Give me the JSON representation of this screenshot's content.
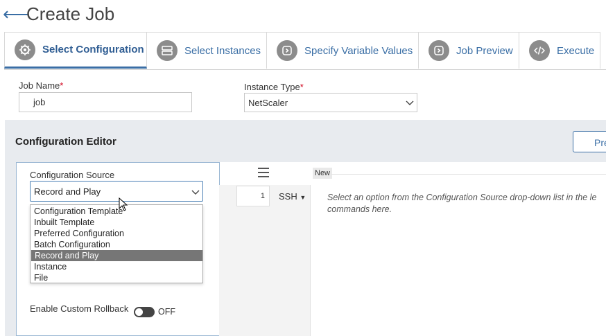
{
  "header": {
    "back_icon": "back-arrow-icon",
    "title": "Create Job"
  },
  "tabs": [
    {
      "label": "Select Configuration",
      "icon": "gear-icon",
      "active": true
    },
    {
      "label": "Select Instances",
      "icon": "server-icon",
      "active": false
    },
    {
      "label": "Specify Variable Values",
      "icon": "play-icon",
      "active": false
    },
    {
      "label": "Job Preview",
      "icon": "play-icon",
      "active": false
    },
    {
      "label": "Execute",
      "icon": "code-icon",
      "active": false
    }
  ],
  "form": {
    "job_name_label": "Job Name",
    "job_name_value": "job",
    "instance_type_label": "Instance Type",
    "instance_type_value": "NetScaler",
    "required_mark": "*"
  },
  "editor": {
    "title": "Configuration Editor",
    "preview_button_partial": "Pre",
    "source_label": "Configuration Source",
    "source_value": "Record and Play",
    "source_options": [
      "Configuration Template",
      "Inbuilt Template",
      "Preferred Configuration",
      "Batch Configuration",
      "Record and Play",
      "Instance",
      "File"
    ],
    "selected_option_index": 4,
    "new_tag": "New",
    "line_number": "1",
    "ssh_label": "SSH",
    "hint_line1": "Select an option from the Configuration Source drop-down list in the le",
    "hint_line2": "commands here.",
    "rollback_label": "Enable Custom Rollback",
    "rollback_state": "OFF"
  },
  "colors": {
    "accent": "#3a6ea5",
    "editor_bg": "#e8ebef",
    "selected_option_bg": "#767676",
    "required": "#d0021b"
  }
}
